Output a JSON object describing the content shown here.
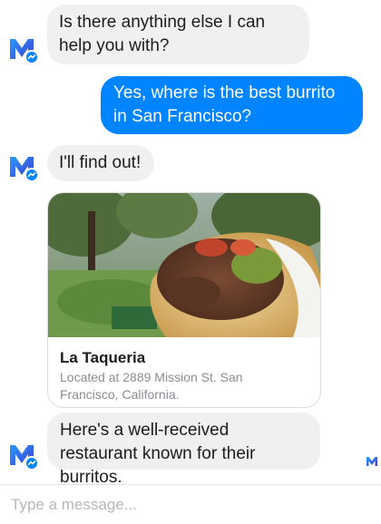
{
  "messages": [
    {
      "from": "m",
      "text": "Is there anything else I can help you with?"
    },
    {
      "from": "user",
      "text": "Yes, where is the best burrito in San Francisco?"
    },
    {
      "from": "m",
      "text": "I'll find out!"
    },
    {
      "from": "m",
      "text": "Here's a well-received restaurant known for their burritos."
    }
  ],
  "card": {
    "title": "La Taqueria",
    "subtitle": "Located at 2889 Mission St. San Francisco, California."
  },
  "composer": {
    "placeholder": "Type a message..."
  },
  "icons": {
    "avatar": "m-assistant-avatar-icon",
    "seen": "seen-receipt-icon"
  },
  "colors": {
    "outgoing_bubble": "#0084ff",
    "incoming_bubble": "#f1f0f0"
  }
}
